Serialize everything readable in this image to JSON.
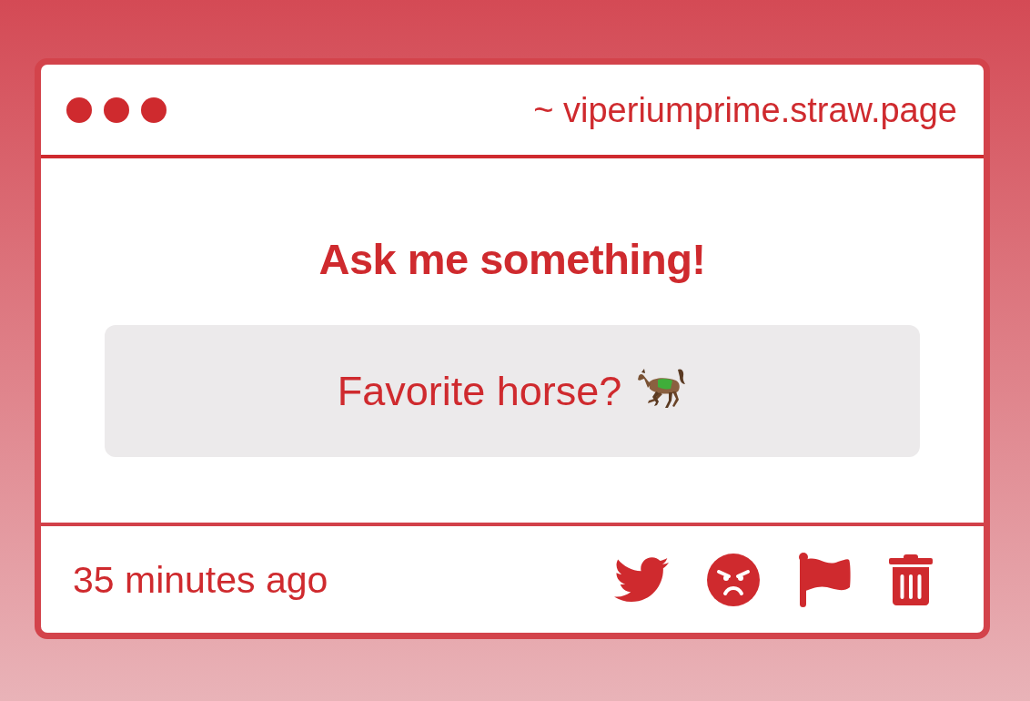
{
  "window": {
    "url": "~ viperiumprime.straw.page"
  },
  "prompt": {
    "heading": "Ask me something!"
  },
  "question": {
    "text": "Favorite horse?"
  },
  "footer": {
    "time": "35 minutes ago"
  }
}
